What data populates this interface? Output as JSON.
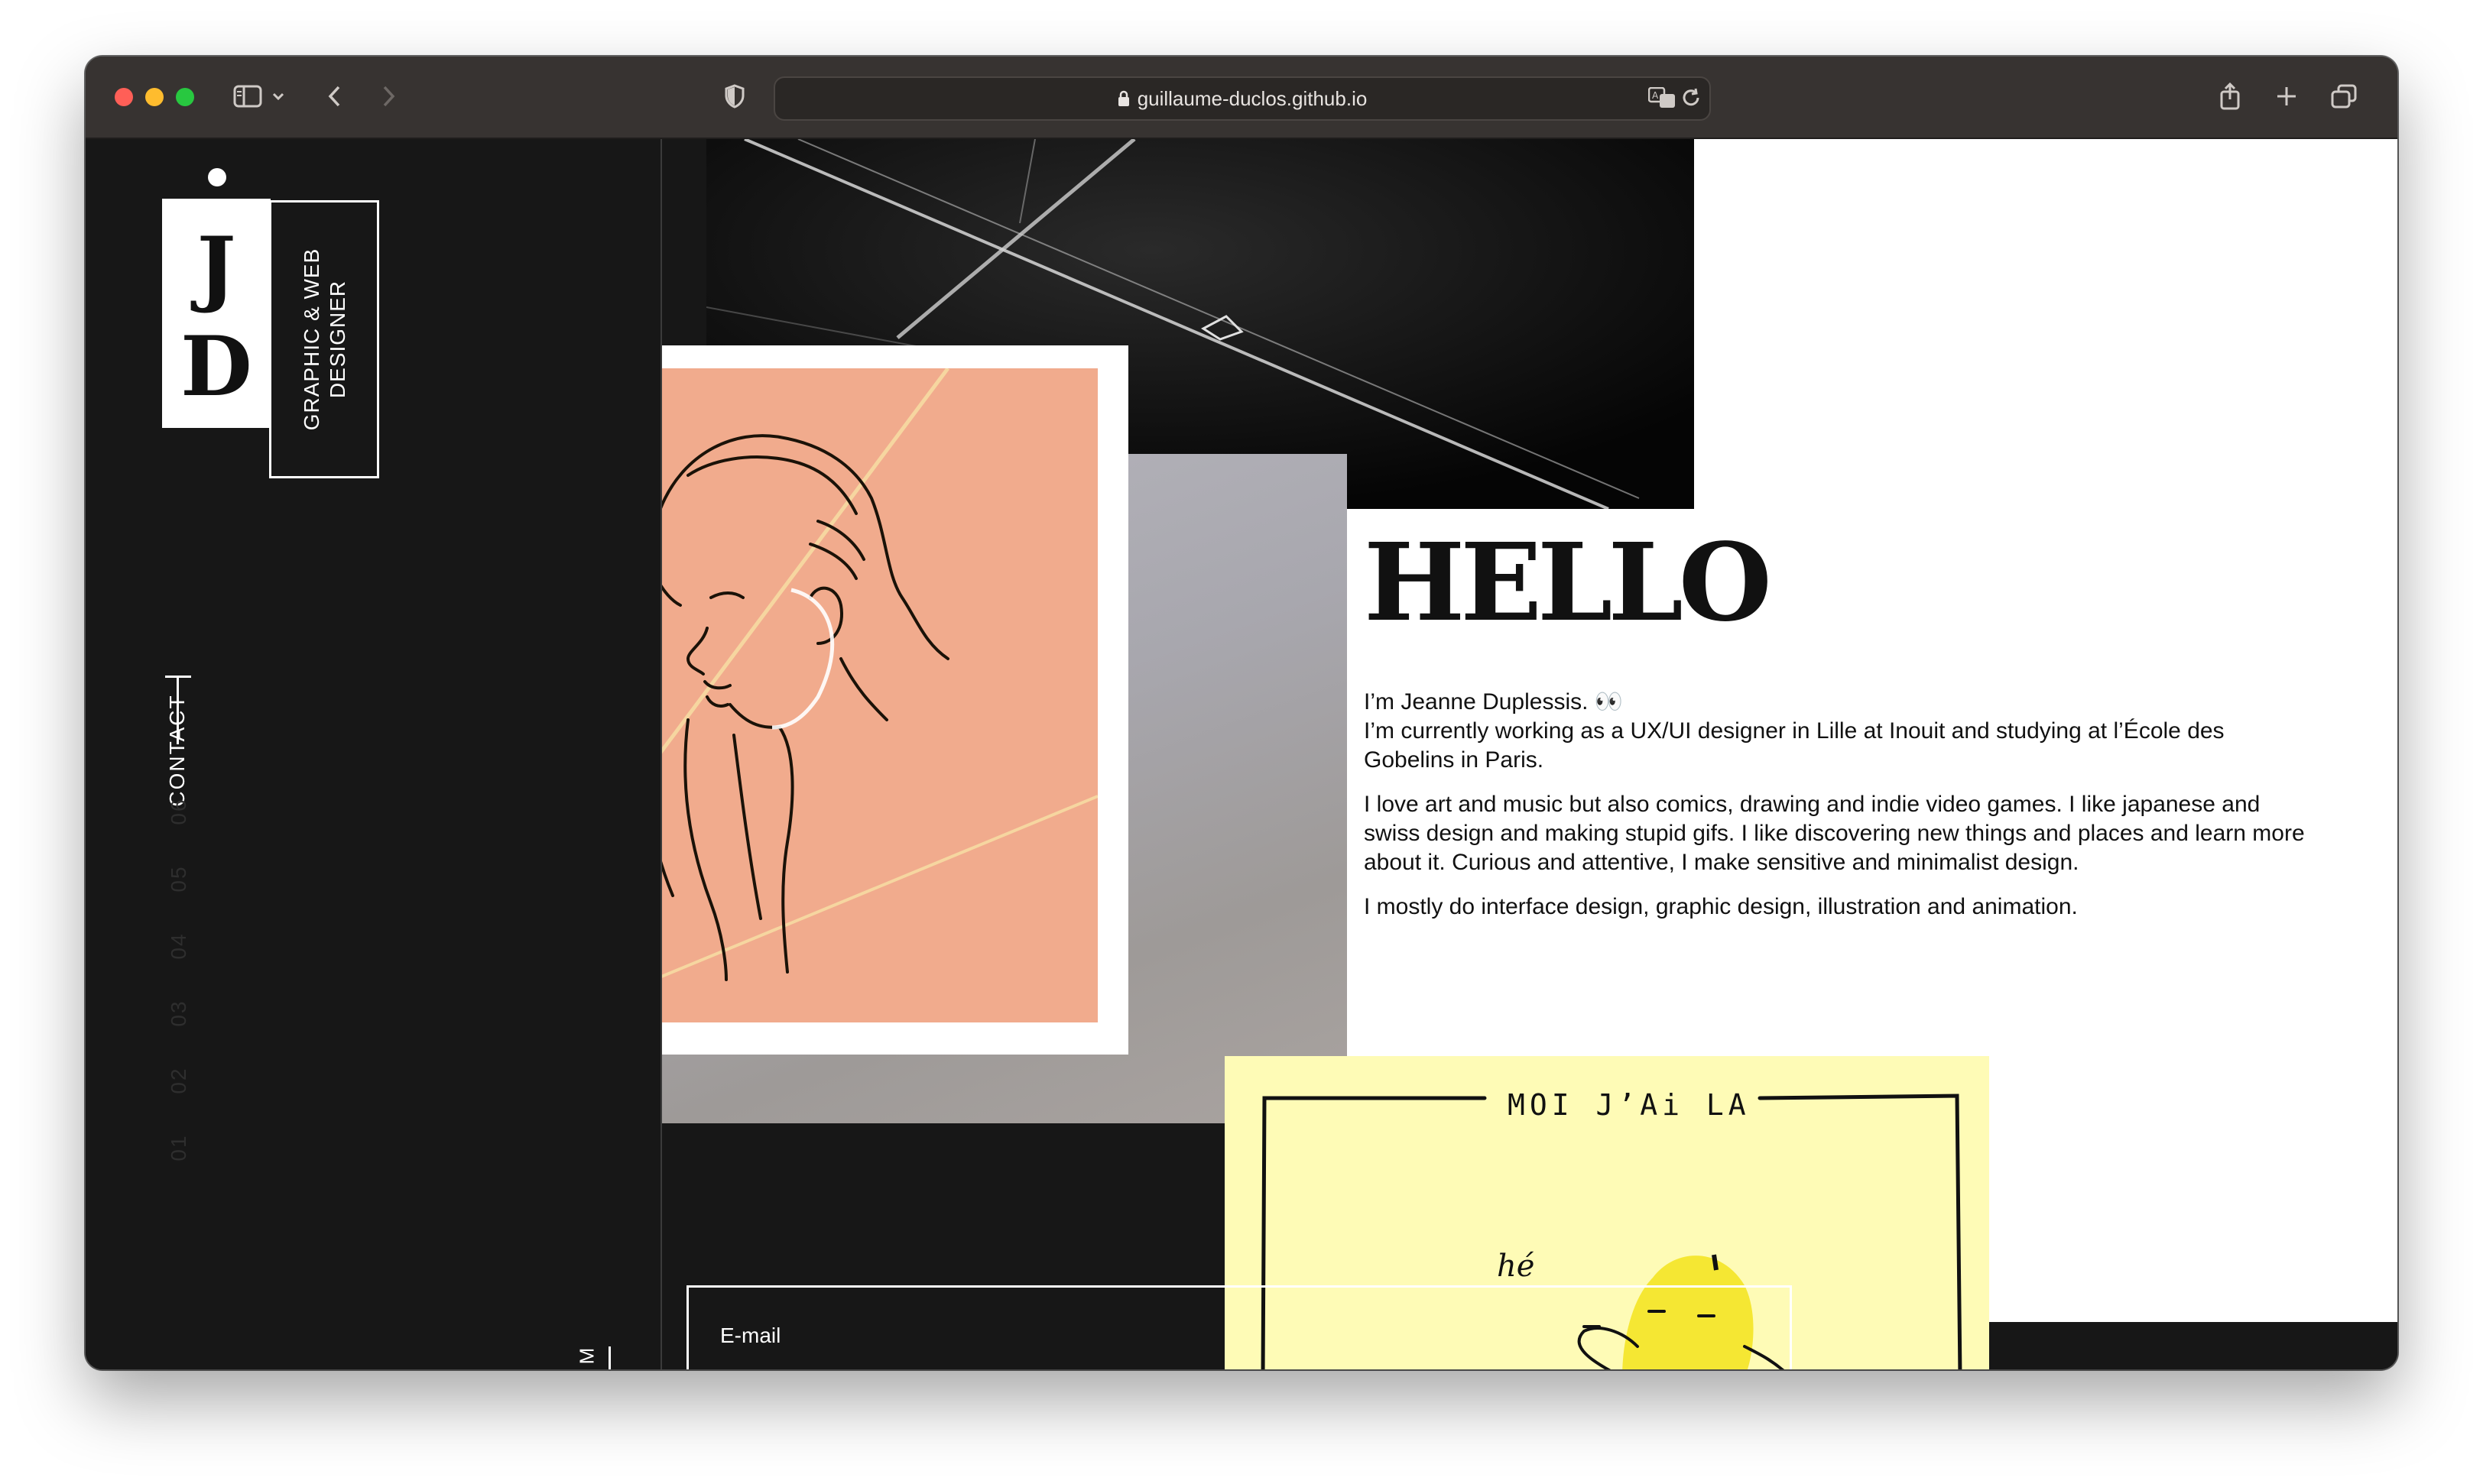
{
  "browser": {
    "url": "guillaume-duclos.github.io",
    "icons": [
      "sidebar-icon",
      "chevron-down-icon",
      "back-icon",
      "forward-icon",
      "shield-icon",
      "lock-icon",
      "translate-icon",
      "reload-icon",
      "share-icon",
      "new-tab-icon",
      "tab-overview-icon"
    ]
  },
  "logo": {
    "letter1": "J",
    "letter2": "D",
    "tagline_line1": "GRAPHIC & WEB",
    "tagline_line2": "DESIGNER"
  },
  "sidebar": {
    "contact_label": "CONTACT",
    "section_numbers": [
      "06",
      "05",
      "04",
      "03",
      "02",
      "01"
    ],
    "social_label": "M"
  },
  "hero": {
    "title": "HELLO",
    "paragraph1_line1": "I’m Jeanne Duplessis. 👀",
    "paragraph1_line2": "I’m currently working as a UX/UI designer in Lille at Inouit and studying at l’École des Gobelins in Paris.",
    "paragraph2": "I love art and music but also comics, drawing and indie video games. I like japanese and swiss design and making stupid gifs. I like discovering new things and places and learn more about it. Curious and attentive, I make sensitive and minimalist design.",
    "paragraph3": "I mostly do interface design, graphic design, illustration  and animation."
  },
  "illustration": {
    "comic_title": "MOI J’Ai LA",
    "comic_word": "hé"
  },
  "contact_form": {
    "email_label": "E-mail"
  },
  "colors": {
    "background": "#171717",
    "salmon": "#f1ab8d",
    "yellow": "#fefbb6",
    "text": "#111111"
  }
}
